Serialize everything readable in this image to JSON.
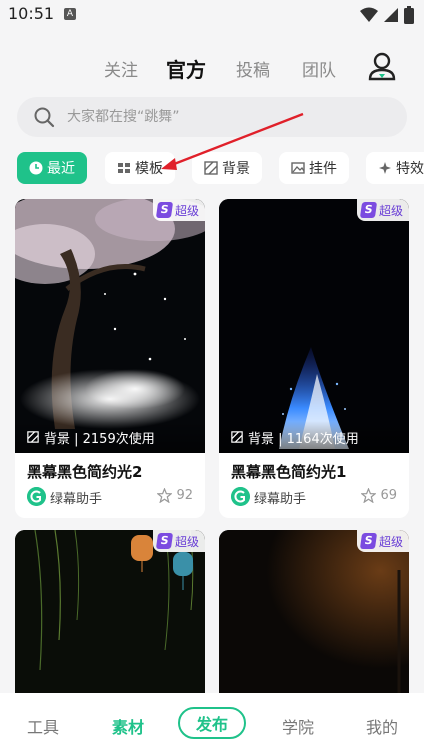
{
  "status_bar": {
    "time": "10:51",
    "notif_letter": "A"
  },
  "top_tabs": [
    {
      "label": "关注"
    },
    {
      "label": "官方"
    },
    {
      "label": "投稿"
    },
    {
      "label": "团队"
    }
  ],
  "search": {
    "placeholder": "大家都在搜“跳舞”"
  },
  "chips": [
    {
      "label": "最近",
      "icon": "clock-icon"
    },
    {
      "label": "模板",
      "icon": "template-icon"
    },
    {
      "label": "背景",
      "icon": "background-icon"
    },
    {
      "label": "挂件",
      "icon": "image-icon"
    },
    {
      "label": "特效",
      "icon": "sparkle-icon"
    }
  ],
  "badge_label": "超级",
  "cards": [
    {
      "usage": "背景 | 2159次使用",
      "title": "黑幕黑色简约光2",
      "author": "绿幕助手",
      "likes": "92"
    },
    {
      "usage": "背景 | 1164次使用",
      "title": "黑幕黑色简约光1",
      "author": "绿幕助手",
      "likes": "69"
    },
    {
      "usage": "",
      "title": "",
      "author": "",
      "likes": ""
    },
    {
      "usage": "",
      "title": "",
      "author": "",
      "likes": ""
    }
  ],
  "bottom_nav": {
    "tools": "工具",
    "materials": "素材",
    "publish": "发布",
    "academy": "学院",
    "mine": "我的"
  },
  "colors": {
    "accent": "#1fc28a",
    "badge": "#7b4be0",
    "arrow": "#e0202a"
  }
}
